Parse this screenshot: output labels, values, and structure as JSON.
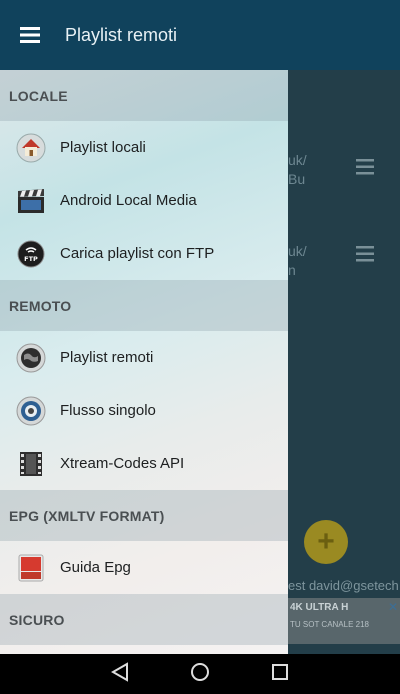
{
  "appbar": {
    "title": "Playlist remoti",
    "menu_icon": "hamburger-icon"
  },
  "background": {
    "row1": {
      "line1": "uk/",
      "line2": "Bu"
    },
    "row2": {
      "line1": "uk/",
      "line2": "n"
    },
    "email_fragment": "est david@gsetech",
    "ad": {
      "headline": "4K ULTRA H",
      "sub": "TU SOT   CANALE 218"
    }
  },
  "drawer": {
    "sections": [
      {
        "title": "LOCALE",
        "items": [
          {
            "label": "Playlist locali",
            "icon": "house-icon"
          },
          {
            "label": "Android Local Media",
            "icon": "clapperboard-icon"
          },
          {
            "label": "Carica playlist con FTP",
            "icon": "ftp-icon"
          }
        ]
      },
      {
        "title": "REMOTO",
        "items": [
          {
            "label": "Playlist remoti",
            "icon": "globe-icon"
          },
          {
            "label": "Flusso singolo",
            "icon": "stream-icon"
          },
          {
            "label": "Xtream-Codes API",
            "icon": "film-reel-icon"
          }
        ]
      },
      {
        "title": "EPG (XMLTV FORMAT)",
        "items": [
          {
            "label": "Guida Epg",
            "icon": "tv-guide-icon"
          }
        ]
      },
      {
        "title": "SICURO",
        "items": []
      }
    ]
  },
  "navbar": {
    "back": "back-icon",
    "home": "home-icon",
    "recents": "recents-icon"
  },
  "colors": {
    "appbar": "#10425c",
    "fab": "#9a8a22",
    "nav": "#000000"
  }
}
